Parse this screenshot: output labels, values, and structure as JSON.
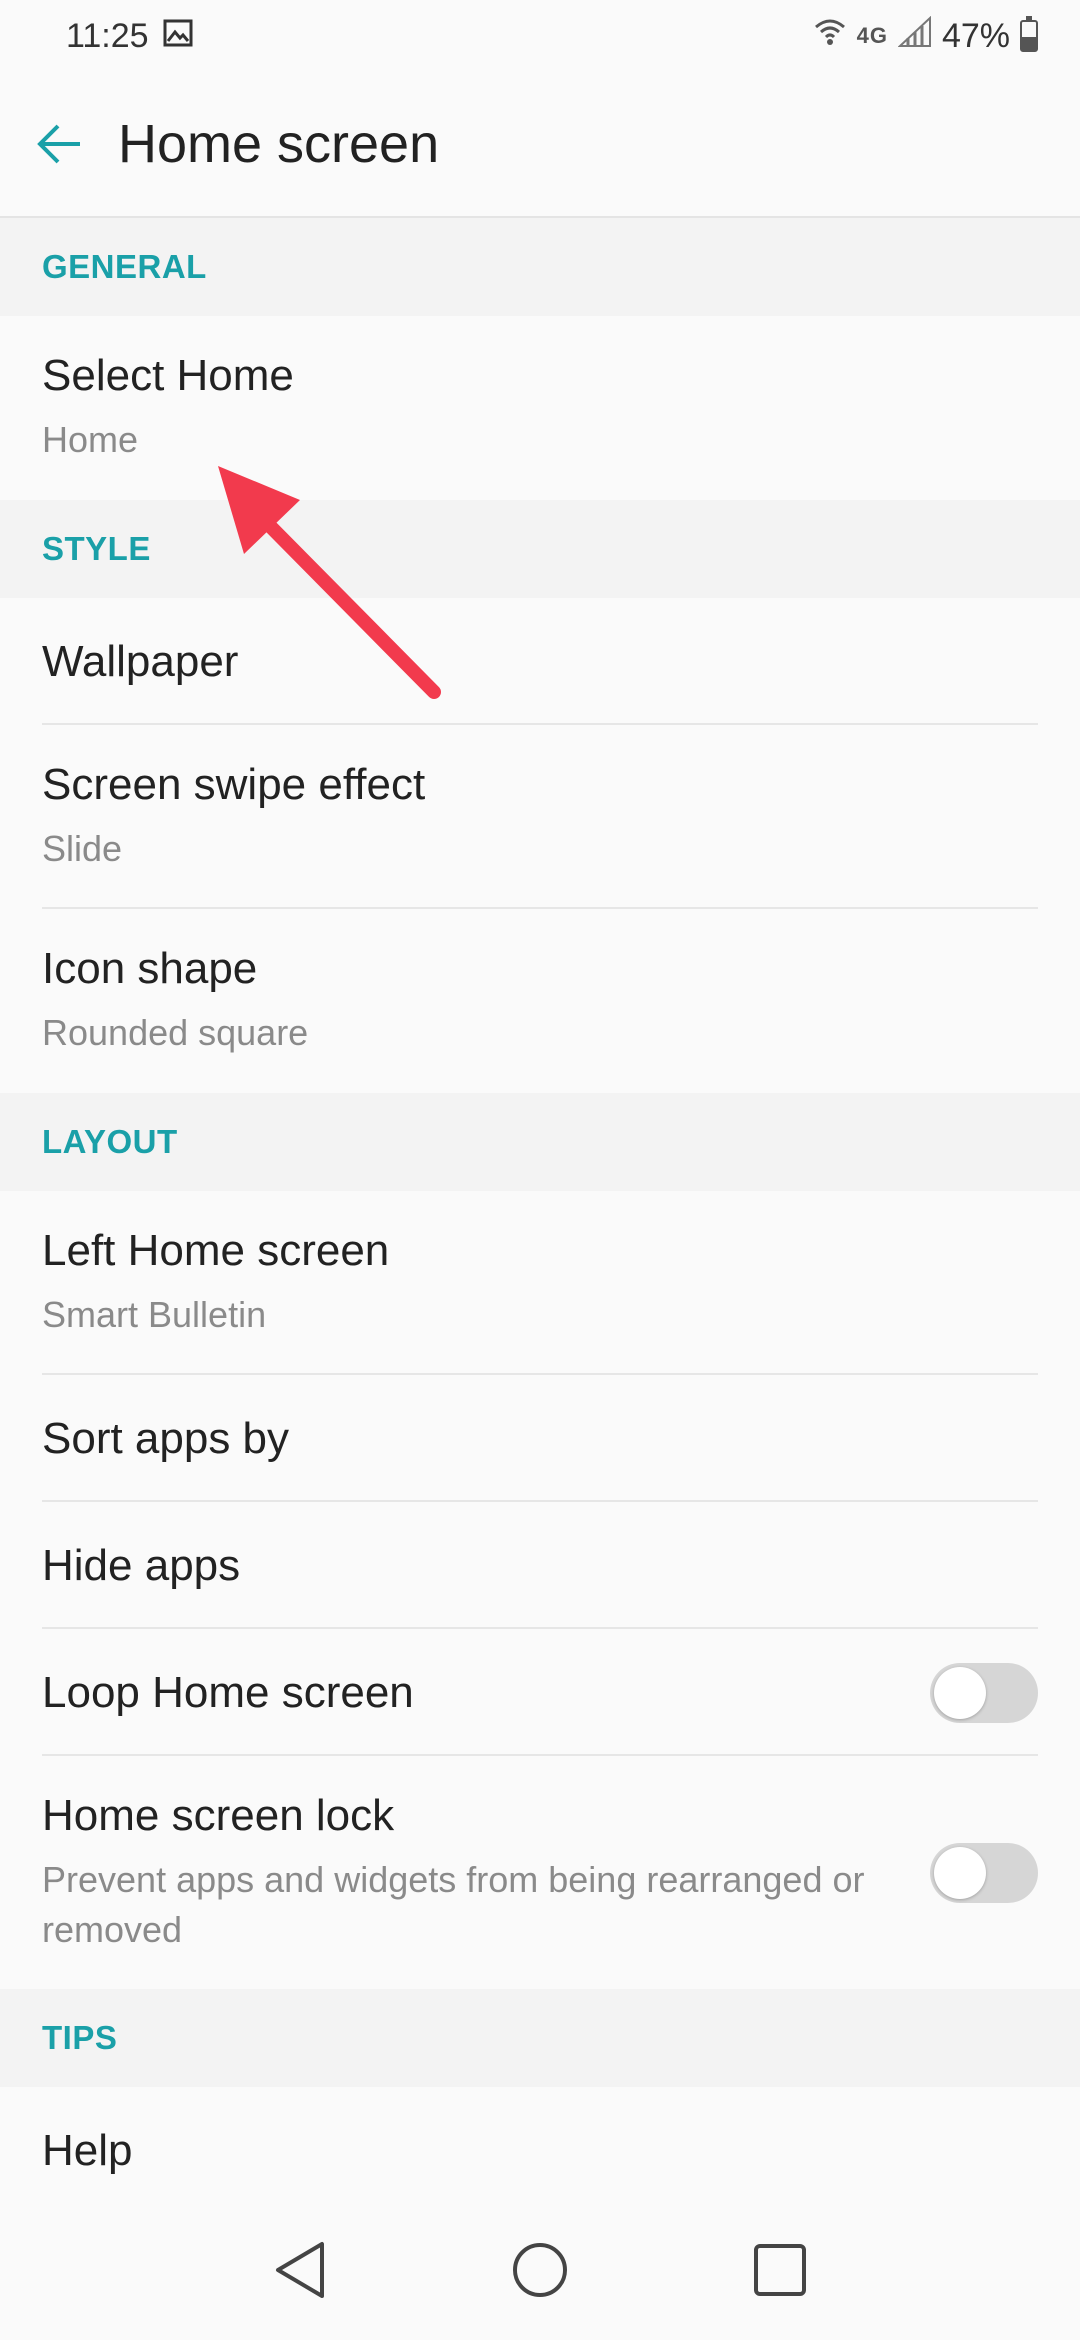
{
  "status_bar": {
    "time": "11:25",
    "network": "4G",
    "battery": "47%",
    "icons": [
      "image-icon",
      "wifi-icon",
      "signal-icon",
      "battery-icon"
    ]
  },
  "toolbar": {
    "title": "Home screen"
  },
  "sections": {
    "general": {
      "header": "GENERAL",
      "select_home": {
        "title": "Select Home",
        "sub": "Home"
      }
    },
    "style": {
      "header": "STYLE",
      "wallpaper": {
        "title": "Wallpaper"
      },
      "swipe": {
        "title": "Screen swipe effect",
        "sub": "Slide"
      },
      "icon_shape": {
        "title": "Icon shape",
        "sub": "Rounded square"
      }
    },
    "layout": {
      "header": "LAYOUT",
      "left_home": {
        "title": "Left Home screen",
        "sub": "Smart Bulletin"
      },
      "sort_apps": {
        "title": "Sort apps by"
      },
      "hide_apps": {
        "title": "Hide apps"
      },
      "loop": {
        "title": "Loop Home screen",
        "toggle_on": false
      },
      "lock": {
        "title": "Home screen lock",
        "sub": "Prevent apps and widgets from being rearranged or removed",
        "toggle_on": false
      }
    },
    "tips": {
      "header": "TIPS",
      "help": {
        "title": "Help"
      }
    }
  },
  "colors": {
    "accent": "#1aa0a8",
    "annotation_arrow": "#f23a4d"
  }
}
